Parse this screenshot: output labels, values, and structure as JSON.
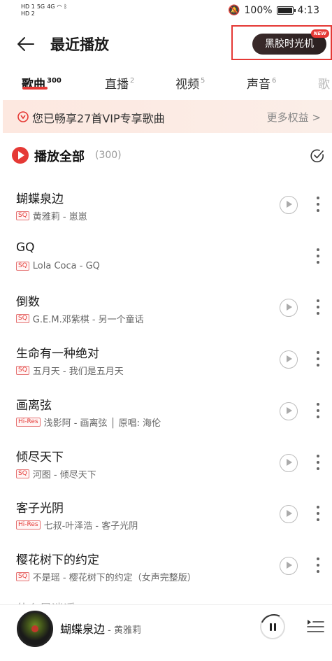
{
  "status_bar": {
    "sim1": "HD 1",
    "sim2": "HD 2",
    "net1": "5G",
    "net2": "4G",
    "battery_pct": "100%",
    "battery_level": 1.0,
    "time": "4:13"
  },
  "header": {
    "title": "最近播放",
    "vinyl_label": "黑胶时光机",
    "new_badge": "NEW"
  },
  "tabs": [
    {
      "label": "歌曲",
      "count": "300",
      "active": true
    },
    {
      "label": "直播",
      "count": "2"
    },
    {
      "label": "视频",
      "count": "5"
    },
    {
      "label": "声音",
      "count": "6"
    },
    {
      "label": "歌"
    }
  ],
  "vip_banner": {
    "text": "您已畅享27首VIP专享歌曲",
    "more": "更多权益 >"
  },
  "play_all": {
    "label": "播放全部",
    "count": "(300)"
  },
  "songs": [
    {
      "title": "蝴蝶泉边",
      "badge": "SQ",
      "meta": "黄雅莉 - 崽崽",
      "playable_video": true
    },
    {
      "title": "GQ",
      "badge": "SQ",
      "meta": "Lola Coca - GQ",
      "playable_video": false
    },
    {
      "title": "倒数",
      "badge": "SQ",
      "meta": "G.E.M.邓紫棋 - 另一个童话",
      "playable_video": true
    },
    {
      "title": "生命有一种绝对",
      "badge": "SQ",
      "meta": "五月天 - 我们是五月天",
      "playable_video": true
    },
    {
      "title": "画离弦",
      "badge": "Hi-Res",
      "meta": "浅影阿 - 画离弦 │ 原唱: 海伦",
      "playable_video": true
    },
    {
      "title": "倾尽天下",
      "badge": "SQ",
      "meta": "河图 - 倾尽天下",
      "playable_video": true
    },
    {
      "title": "客子光阴",
      "badge": "Hi-Res",
      "meta": "七叔-叶泽浩 - 客子光阴",
      "playable_video": true
    },
    {
      "title": "樱花树下的约定",
      "badge": "SQ",
      "meta": "不是瑶 - 樱花树下的约定（女声完整版）",
      "playable_video": true
    }
  ],
  "peek_row": "什么是逍遥",
  "player": {
    "title": "蝴蝶泉边",
    "separator": " - ",
    "artist": "黄雅莉"
  },
  "colors": {
    "accent": "#e53935",
    "vip_bg": "#fde8e0"
  }
}
